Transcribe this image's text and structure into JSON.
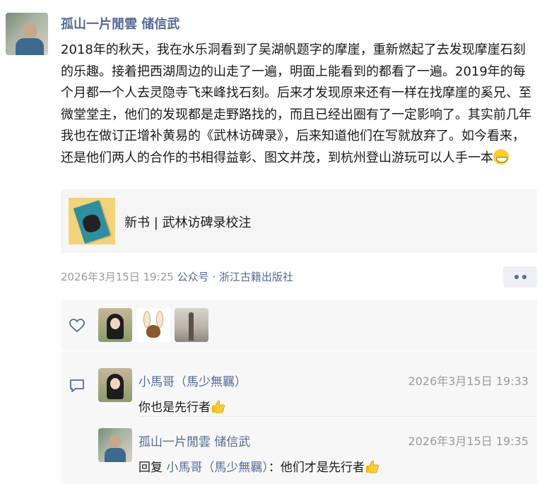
{
  "post": {
    "author": "孤山一片閒雲 储信武",
    "content": "2018年的秋天，我在水乐洞看到了吴湖帆题字的摩崖，重新燃起了去发现摩崖石刻的乐趣。接着把西湖周边的山走了一遍，明面上能看到的都看了一遍。2019年的每个月都一个人去灵隐寺飞来峰找石刻。后来才发现原来还有一样在找摩崖的奚兄、至微堂堂主，他们的发现都是走野路找的，而且已经出圈有了一定影响了。其实前几年我也在做订正增补黄易的《武林访碑录》，后来知道他们在写就放弃了。如今看来，还是他们两人的合作的书相得益彰、图文并茂，到杭州登山游玩可以人手一本",
    "content_emoji": "grinning-face-emoji"
  },
  "article": {
    "title": "新书 | 武林访碑录校注"
  },
  "meta": {
    "time": "2026年3月15日 19:25",
    "source": "公众号 · 浙江古籍出版社"
  },
  "likes": {
    "count": 3
  },
  "comments": [
    {
      "name": "小馬哥（馬少無羈）",
      "time": "2026年3月15日 19:33",
      "text": "你也是先行者",
      "emoji": "thumbs-up-emoji"
    },
    {
      "name": "孤山一片閒雲 储信武",
      "time": "2026年3月15日 19:35",
      "reply_label": "回复",
      "reply_to": "小馬哥（馬少無羈）",
      "separator": "：",
      "text": "他们才是先行者",
      "emoji": "thumbs-up-emoji"
    }
  ],
  "colors": {
    "link": "#576b95",
    "meta": "#9b9b9b",
    "panel": "#f7f7f7"
  }
}
